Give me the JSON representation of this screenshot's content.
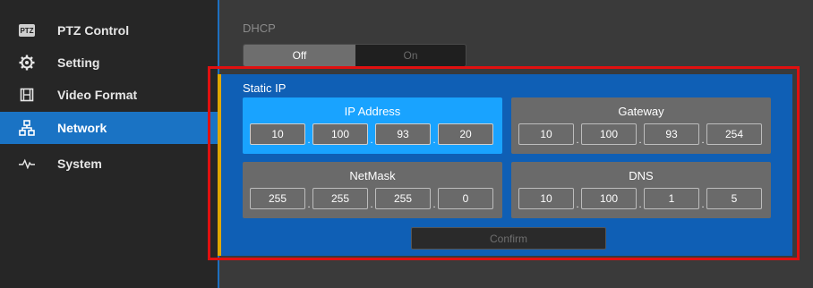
{
  "sidebar": {
    "items": [
      {
        "label": "PTZ Control",
        "icon": "ptz-icon",
        "icon_text": "PTZ"
      },
      {
        "label": "Setting",
        "icon": "gear-icon"
      },
      {
        "label": "Video Format",
        "icon": "film-icon"
      },
      {
        "label": "Network",
        "icon": "network-icon",
        "active": true
      },
      {
        "label": "System",
        "icon": "pulse-icon"
      }
    ]
  },
  "dhcp": {
    "label": "DHCP",
    "off_label": "Off",
    "on_label": "On",
    "selected": "Off"
  },
  "static_ip": {
    "label": "Static IP",
    "ip_address": {
      "title": "IP Address",
      "octets": [
        "10",
        "100",
        "93",
        "20"
      ]
    },
    "gateway": {
      "title": "Gateway",
      "octets": [
        "10",
        "100",
        "93",
        "254"
      ]
    },
    "netmask": {
      "title": "NetMask",
      "octets": [
        "255",
        "255",
        "255",
        "0"
      ]
    },
    "dns": {
      "title": "DNS",
      "octets": [
        "10",
        "100",
        "1",
        "5"
      ]
    },
    "separator": ".",
    "confirm_label": "Confirm"
  },
  "colors": {
    "accent": "#1a73c4",
    "panel": "#0f5fb5",
    "highlight_group": "#19a3ff",
    "indicator": "#e0a800",
    "annotation_frame": "#e01010"
  }
}
